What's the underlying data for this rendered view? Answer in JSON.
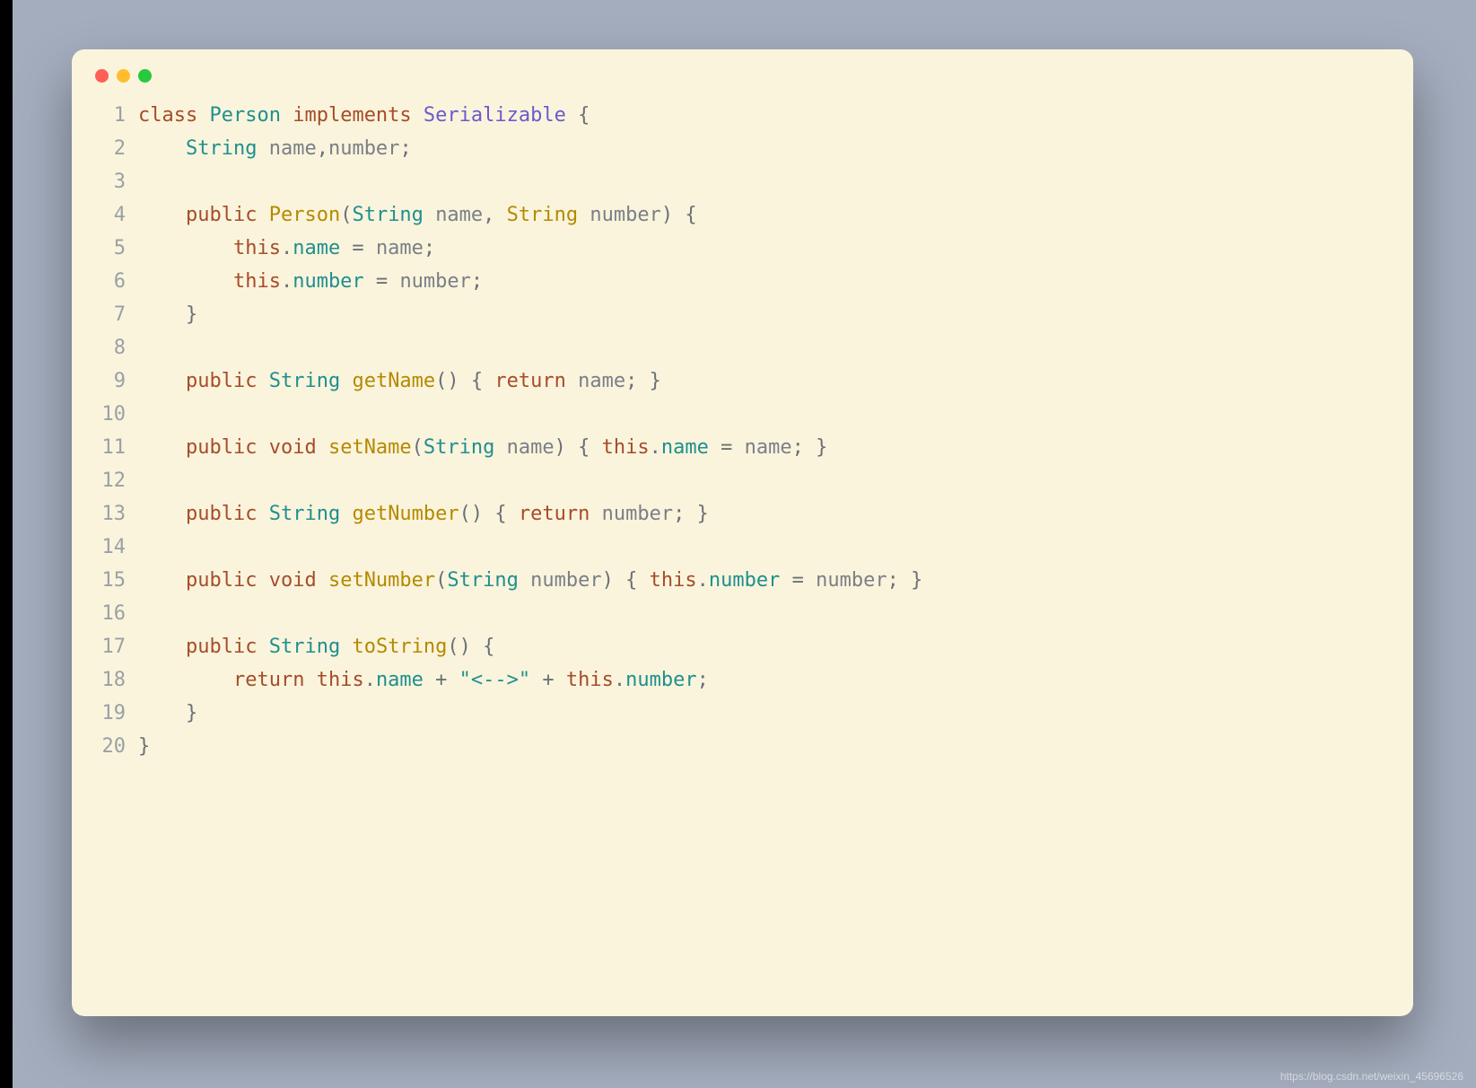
{
  "watermark": "https://blog.csdn.net/weixin_45696526",
  "code": {
    "lines": [
      {
        "n": "1",
        "tokens": [
          {
            "c": "kw",
            "t": "class"
          },
          {
            "t": " "
          },
          {
            "c": "type",
            "t": "Person"
          },
          {
            "t": " "
          },
          {
            "c": "kw",
            "t": "implements"
          },
          {
            "t": " "
          },
          {
            "c": "iface",
            "t": "Serializable"
          },
          {
            "t": " "
          },
          {
            "c": "punct",
            "t": "{"
          }
        ]
      },
      {
        "n": "2",
        "indent": 1,
        "tokens": [
          {
            "c": "type",
            "t": "String"
          },
          {
            "t": " "
          },
          {
            "c": "param",
            "t": "name"
          },
          {
            "c": "punct",
            "t": ","
          },
          {
            "c": "param",
            "t": "number"
          },
          {
            "c": "punct",
            "t": ";"
          }
        ]
      },
      {
        "n": "3",
        "tokens": []
      },
      {
        "n": "4",
        "indent": 1,
        "tokens": [
          {
            "c": "kw",
            "t": "public"
          },
          {
            "t": " "
          },
          {
            "c": "fn",
            "t": "Person"
          },
          {
            "c": "punct",
            "t": "("
          },
          {
            "c": "type",
            "t": "String"
          },
          {
            "t": " "
          },
          {
            "c": "param",
            "t": "name"
          },
          {
            "c": "punct",
            "t": ", "
          },
          {
            "c": "fn",
            "t": "String"
          },
          {
            "t": " "
          },
          {
            "c": "param",
            "t": "number"
          },
          {
            "c": "punct",
            "t": ") {"
          }
        ]
      },
      {
        "n": "5",
        "indent": 2,
        "tokens": [
          {
            "c": "kw",
            "t": "this"
          },
          {
            "c": "punct",
            "t": "."
          },
          {
            "c": "type",
            "t": "name"
          },
          {
            "c": "punct",
            "t": " = "
          },
          {
            "c": "param",
            "t": "name"
          },
          {
            "c": "punct",
            "t": ";"
          }
        ]
      },
      {
        "n": "6",
        "indent": 2,
        "tokens": [
          {
            "c": "kw",
            "t": "this"
          },
          {
            "c": "punct",
            "t": "."
          },
          {
            "c": "type",
            "t": "number"
          },
          {
            "c": "punct",
            "t": " = "
          },
          {
            "c": "param",
            "t": "number"
          },
          {
            "c": "punct",
            "t": ";"
          }
        ]
      },
      {
        "n": "7",
        "indent": 1,
        "tokens": [
          {
            "c": "punct",
            "t": "}"
          }
        ]
      },
      {
        "n": "8",
        "tokens": []
      },
      {
        "n": "9",
        "indent": 1,
        "tokens": [
          {
            "c": "kw",
            "t": "public"
          },
          {
            "t": " "
          },
          {
            "c": "type",
            "t": "String"
          },
          {
            "t": " "
          },
          {
            "c": "fn",
            "t": "getName"
          },
          {
            "c": "punct",
            "t": "() { "
          },
          {
            "c": "kw",
            "t": "return"
          },
          {
            "t": " "
          },
          {
            "c": "param",
            "t": "name"
          },
          {
            "c": "punct",
            "t": "; }"
          }
        ]
      },
      {
        "n": "10",
        "tokens": []
      },
      {
        "n": "11",
        "indent": 1,
        "tokens": [
          {
            "c": "kw",
            "t": "public"
          },
          {
            "t": " "
          },
          {
            "c": "kw",
            "t": "void"
          },
          {
            "t": " "
          },
          {
            "c": "fn",
            "t": "setName"
          },
          {
            "c": "punct",
            "t": "("
          },
          {
            "c": "type",
            "t": "String"
          },
          {
            "t": " "
          },
          {
            "c": "param",
            "t": "name"
          },
          {
            "c": "punct",
            "t": ") { "
          },
          {
            "c": "kw",
            "t": "this"
          },
          {
            "c": "punct",
            "t": "."
          },
          {
            "c": "type",
            "t": "name"
          },
          {
            "c": "punct",
            "t": " = "
          },
          {
            "c": "param",
            "t": "name"
          },
          {
            "c": "punct",
            "t": "; }"
          }
        ]
      },
      {
        "n": "12",
        "tokens": []
      },
      {
        "n": "13",
        "indent": 1,
        "tokens": [
          {
            "c": "kw",
            "t": "public"
          },
          {
            "t": " "
          },
          {
            "c": "type",
            "t": "String"
          },
          {
            "t": " "
          },
          {
            "c": "fn",
            "t": "getNumber"
          },
          {
            "c": "punct",
            "t": "() { "
          },
          {
            "c": "kw",
            "t": "return"
          },
          {
            "t": " "
          },
          {
            "c": "param",
            "t": "number"
          },
          {
            "c": "punct",
            "t": "; }"
          }
        ]
      },
      {
        "n": "14",
        "tokens": []
      },
      {
        "n": "15",
        "indent": 1,
        "tokens": [
          {
            "c": "kw",
            "t": "public"
          },
          {
            "t": " "
          },
          {
            "c": "kw",
            "t": "void"
          },
          {
            "t": " "
          },
          {
            "c": "fn",
            "t": "setNumber"
          },
          {
            "c": "punct",
            "t": "("
          },
          {
            "c": "type",
            "t": "String"
          },
          {
            "t": " "
          },
          {
            "c": "param",
            "t": "number"
          },
          {
            "c": "punct",
            "t": ") { "
          },
          {
            "c": "kw",
            "t": "this"
          },
          {
            "c": "punct",
            "t": "."
          },
          {
            "c": "type",
            "t": "number"
          },
          {
            "c": "punct",
            "t": " = "
          },
          {
            "c": "param",
            "t": "number"
          },
          {
            "c": "punct",
            "t": "; }"
          }
        ]
      },
      {
        "n": "16",
        "tokens": []
      },
      {
        "n": "17",
        "indent": 1,
        "tokens": [
          {
            "c": "kw",
            "t": "public"
          },
          {
            "t": " "
          },
          {
            "c": "type",
            "t": "String"
          },
          {
            "t": " "
          },
          {
            "c": "fn",
            "t": "toString"
          },
          {
            "c": "punct",
            "t": "() {"
          }
        ]
      },
      {
        "n": "18",
        "indent": 2,
        "tokens": [
          {
            "c": "kw",
            "t": "return"
          },
          {
            "t": " "
          },
          {
            "c": "kw",
            "t": "this"
          },
          {
            "c": "punct",
            "t": "."
          },
          {
            "c": "type",
            "t": "name"
          },
          {
            "c": "punct",
            "t": " + "
          },
          {
            "c": "str",
            "t": "\"<-->\""
          },
          {
            "c": "punct",
            "t": " + "
          },
          {
            "c": "kw",
            "t": "this"
          },
          {
            "c": "punct",
            "t": "."
          },
          {
            "c": "type",
            "t": "number"
          },
          {
            "c": "punct",
            "t": ";"
          }
        ]
      },
      {
        "n": "19",
        "indent": 1,
        "tokens": [
          {
            "c": "punct",
            "t": "}"
          }
        ]
      },
      {
        "n": "20",
        "tokens": [
          {
            "c": "punct",
            "t": "}"
          }
        ]
      }
    ]
  }
}
